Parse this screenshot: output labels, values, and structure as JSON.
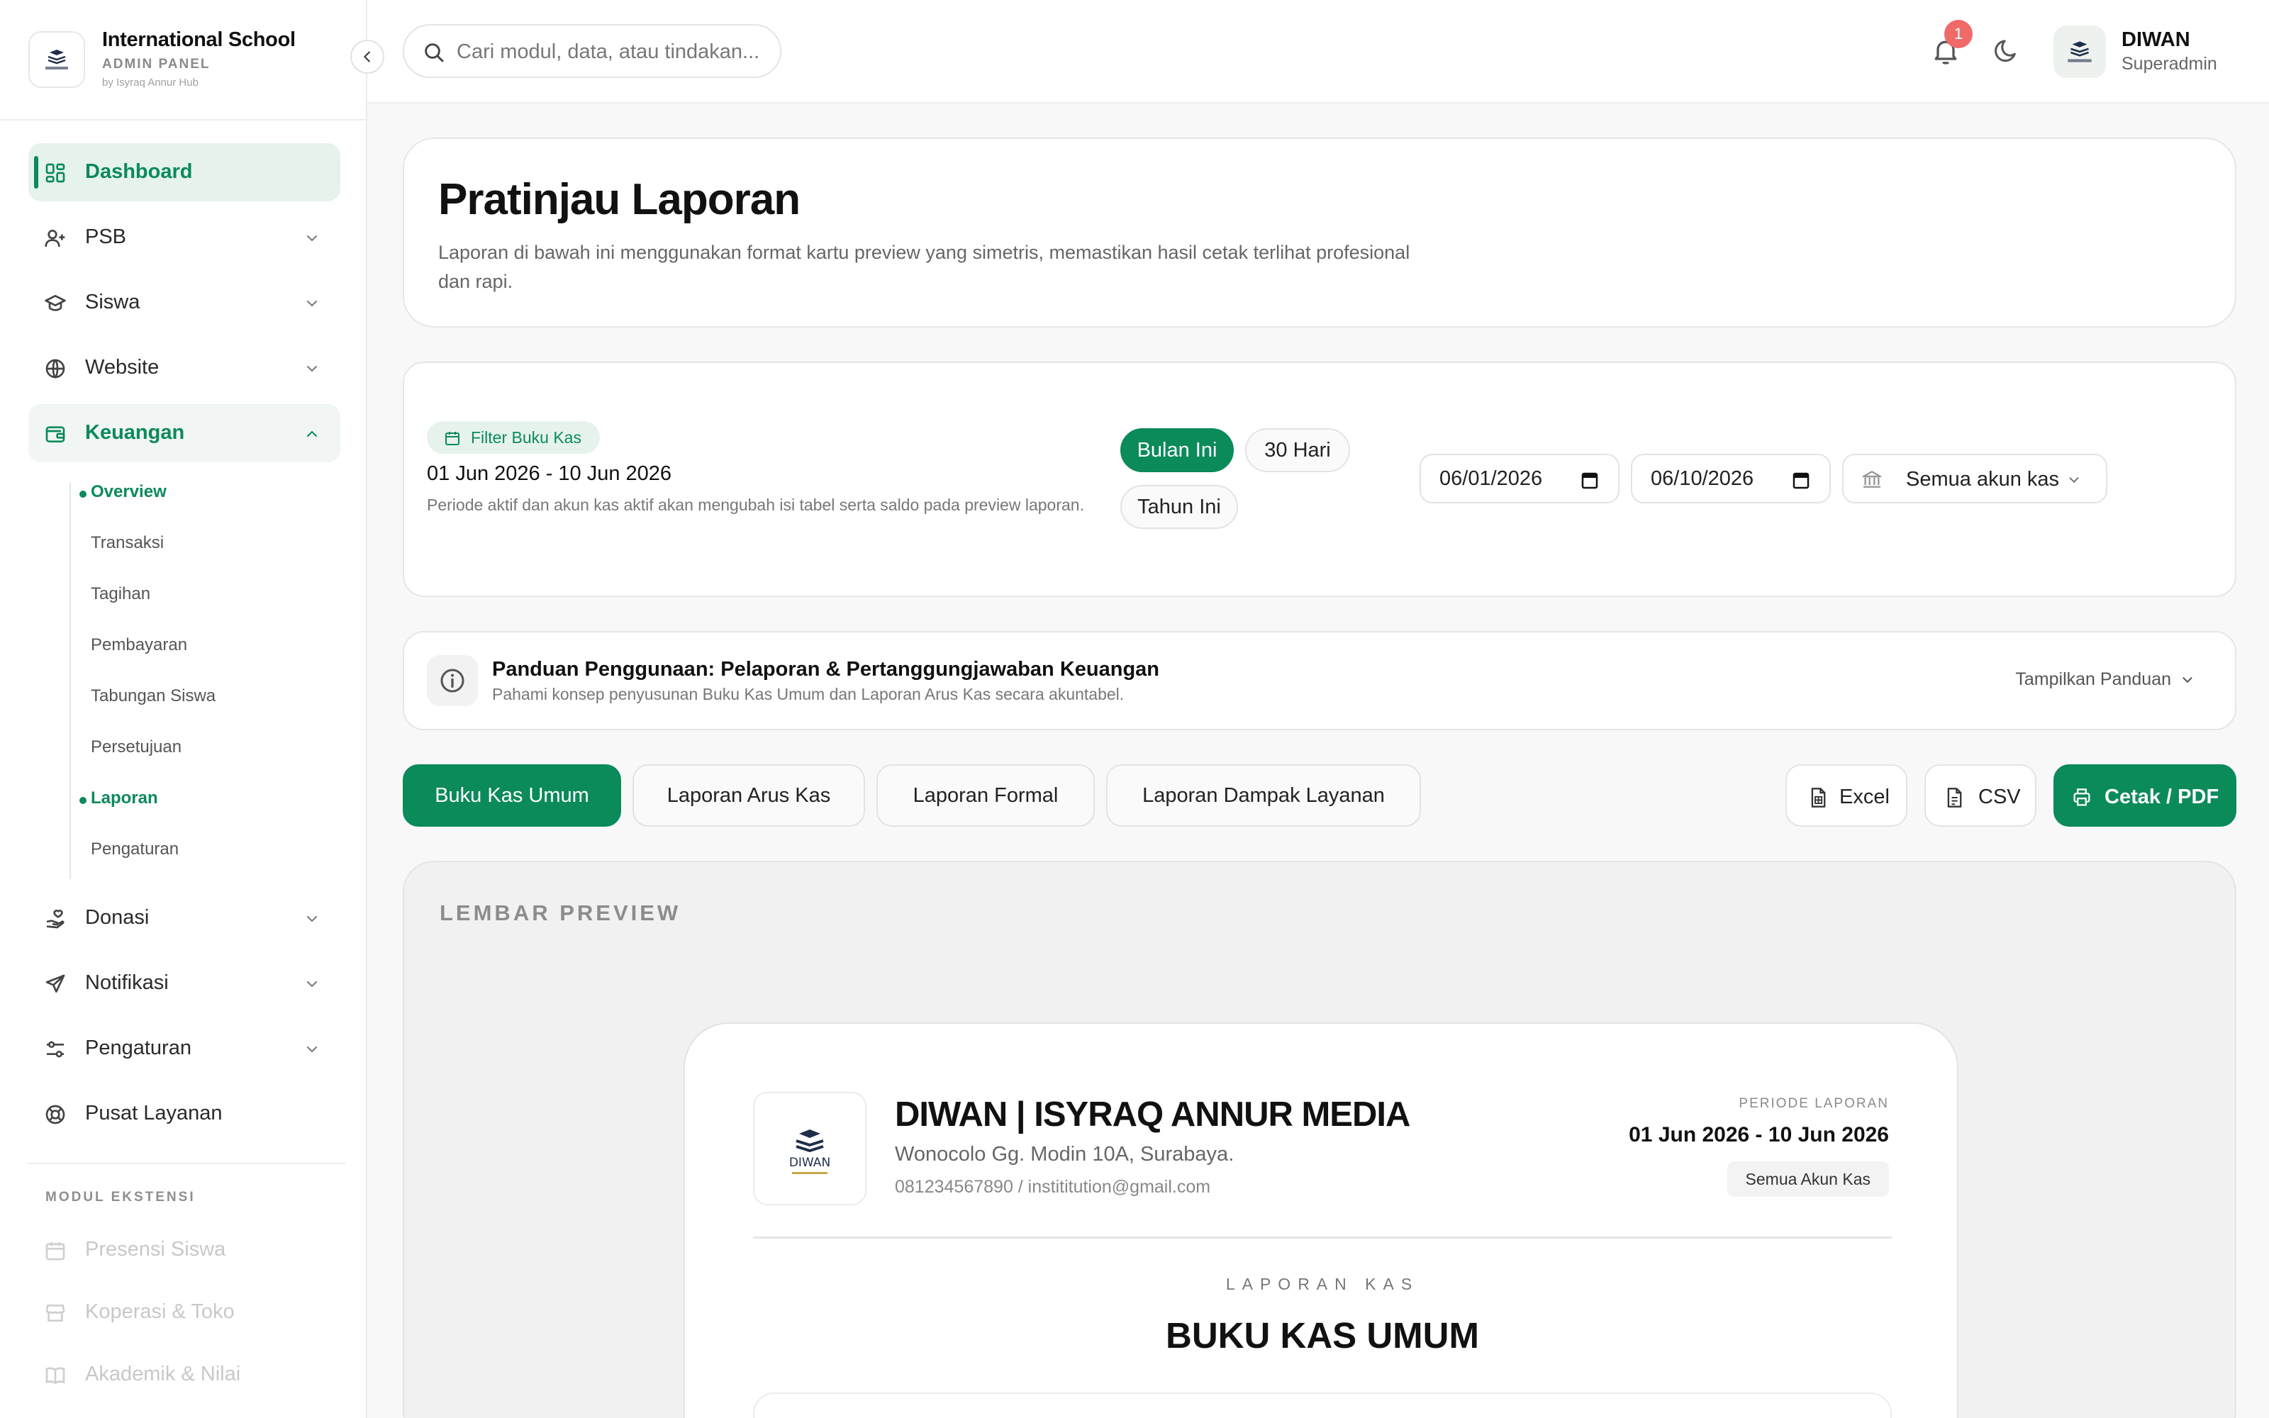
{
  "brand": {
    "title": "International School",
    "subtitle": "ADMIN PANEL",
    "by": "by Isyraq Annur Hub",
    "logo_text": "DIWAN"
  },
  "sidebar": {
    "items": [
      {
        "label": "Dashboard",
        "icon": "grid-icon"
      },
      {
        "label": "PSB",
        "icon": "user-plus-icon"
      },
      {
        "label": "Siswa",
        "icon": "graduation-cap-icon"
      },
      {
        "label": "Website",
        "icon": "globe-icon"
      },
      {
        "label": "Keuangan",
        "icon": "wallet-icon"
      },
      {
        "label": "Donasi",
        "icon": "hand-heart-icon"
      },
      {
        "label": "Notifikasi",
        "icon": "send-icon"
      },
      {
        "label": "Pengaturan",
        "icon": "sliders-icon"
      },
      {
        "label": "Pusat Layanan",
        "icon": "lifebuoy-icon"
      }
    ],
    "keuangan_sub": [
      "Overview",
      "Transaksi",
      "Tagihan",
      "Pembayaran",
      "Tabungan Siswa",
      "Persetujuan",
      "Laporan",
      "Pengaturan"
    ],
    "section_label": "MODUL EKSTENSI",
    "extensions": [
      {
        "label": "Presensi Siswa",
        "icon": "calendar-icon"
      },
      {
        "label": "Koperasi & Toko",
        "icon": "store-icon"
      },
      {
        "label": "Akademik & Nilai",
        "icon": "book-icon"
      }
    ]
  },
  "topbar": {
    "search_placeholder": "Cari modul, data, atau tindakan...",
    "notification_count": "1",
    "user_name": "DIWAN",
    "user_role": "Superadmin"
  },
  "header": {
    "title": "Pratinjau Laporan",
    "description": "Laporan di bawah ini menggunakan format kartu preview yang simetris, memastikan hasil cetak terlihat profesional dan rapi."
  },
  "filter": {
    "chip": "Filter Buku Kas",
    "range": "01 Jun 2026 - 10 Jun 2026",
    "note": "Periode aktif dan akun kas aktif akan mengubah isi tabel serta saldo pada preview laporan.",
    "presets": [
      "Bulan Ini",
      "30 Hari",
      "Tahun Ini"
    ],
    "active_preset": "Bulan Ini",
    "date_from": "06/01/2026",
    "date_to": "06/10/2026",
    "account": "Semua akun kas"
  },
  "guide": {
    "title": "Panduan Penggunaan: Pelaporan & Pertanggungjawaban Keuangan",
    "subtitle": "Pahami konsep penyusunan Buku Kas Umum dan Laporan Arus Kas secara akuntabel.",
    "toggle": "Tampilkan Panduan"
  },
  "tabs": [
    "Buku Kas Umum",
    "Laporan Arus Kas",
    "Laporan Formal",
    "Laporan Dampak Layanan"
  ],
  "actions": {
    "excel": "Excel",
    "csv": "CSV",
    "print": "Cetak / PDF"
  },
  "preview": {
    "label": "LEMBAR PREVIEW",
    "org_name": "DIWAN | ISYRAQ ANNUR MEDIA",
    "address": "Wonocolo Gg. Modin 10A, Surabaya.",
    "contact": "081234567890 / instititution@gmail.com",
    "period_label": "PERIODE LAPORAN",
    "period_value": "01 Jun 2026 - 10 Jun 2026",
    "account_chip": "Semua Akun Kas",
    "kicker": "LAPORAN KAS",
    "report_title": "BUKU KAS UMUM"
  },
  "colors": {
    "accent": "#0b8a5a",
    "accent_soft": "#e6f2ec",
    "badge": "#f06a6a"
  }
}
